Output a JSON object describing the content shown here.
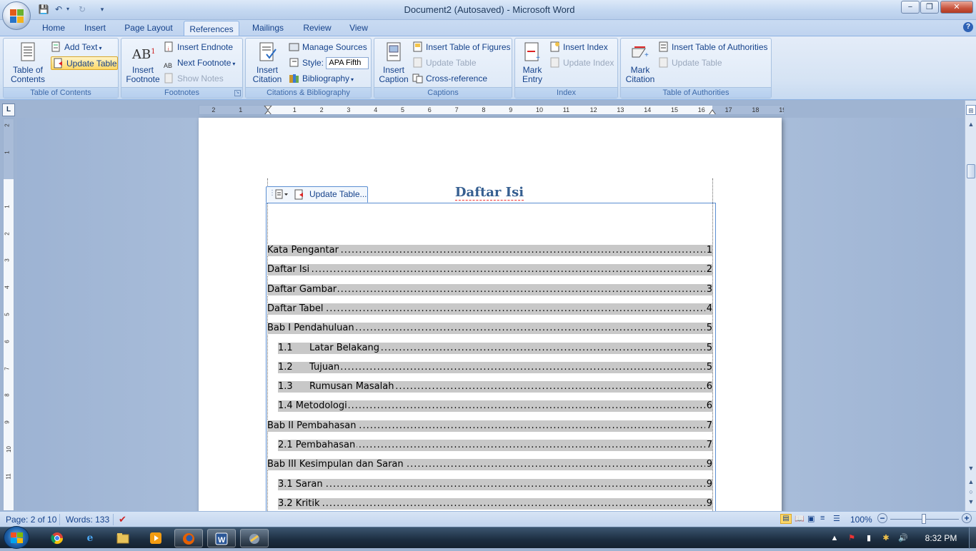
{
  "window": {
    "title": "Document2 (Autosaved) - Microsoft Word",
    "minimize": "−",
    "restore": "❐",
    "close": "✕"
  },
  "tabs": [
    "Home",
    "Insert",
    "Page Layout",
    "References",
    "Mailings",
    "Review",
    "View"
  ],
  "active_tab": "References",
  "ribbon": {
    "toc": {
      "label": "Table of Contents",
      "table_of_contents": "Table of Contents",
      "add_text": "Add Text",
      "update_table": "Update Table"
    },
    "footnotes": {
      "label": "Footnotes",
      "insert_footnote": "Insert Footnote",
      "insert_endnote": "Insert Endnote",
      "next_footnote": "Next Footnote",
      "show_notes": "Show Notes"
    },
    "citations": {
      "label": "Citations & Bibliography",
      "insert_citation": "Insert Citation",
      "manage_sources": "Manage Sources",
      "style_label": "Style:",
      "style_value": "APA Fifth",
      "bibliography": "Bibliography"
    },
    "captions": {
      "label": "Captions",
      "insert_caption": "Insert Caption",
      "insert_table_of_figures": "Insert Table of Figures",
      "update_table": "Update Table",
      "cross_reference": "Cross-reference"
    },
    "index": {
      "label": "Index",
      "mark_entry": "Mark Entry",
      "insert_index": "Insert Index",
      "update_index": "Update Index"
    },
    "authorities": {
      "label": "Table of Authorities",
      "mark_citation": "Mark Citation",
      "insert_toa": "Insert Table of Authorities",
      "update_table": "Update Table"
    }
  },
  "ruler": {
    "numbers": [
      "2",
      "1",
      "1",
      "2",
      "3",
      "4",
      "5",
      "6",
      "7",
      "8",
      "9",
      "10",
      "11",
      "12",
      "13",
      "14",
      "15",
      "16",
      "17",
      "18",
      "19"
    ],
    "vnumbers": [
      "2",
      "1",
      "1",
      "2",
      "3",
      "4",
      "5",
      "6",
      "7",
      "8",
      "9",
      "10",
      "11"
    ],
    "tab_selector": "L"
  },
  "document": {
    "toc_control_label": "Update Table...",
    "heading": "Daftar Isi",
    "toc": [
      {
        "title": "Kata Pengantar",
        "page": "1",
        "level": 1
      },
      {
        "title": "Daftar Isi",
        "page": "2",
        "level": 1
      },
      {
        "title": "Daftar Gambar",
        "page": "3",
        "level": 1
      },
      {
        "title": "Daftar Tabel",
        "page": "4",
        "level": 1
      },
      {
        "title": "Bab I Pendahuluan",
        "page": "5",
        "level": 1
      },
      {
        "num": "1.1",
        "title": "Latar Belakang",
        "page": "5",
        "level": 2
      },
      {
        "num": "1.2",
        "title": "Tujuan",
        "page": "5",
        "level": 2
      },
      {
        "num": "1.3",
        "title": "Rumusan Masalah",
        "page": "6",
        "level": 2
      },
      {
        "title": "1.4 Metodologi",
        "page": "6",
        "level": 2
      },
      {
        "title": "Bab II Pembahasan",
        "page": "7",
        "level": 1
      },
      {
        "title": "2.1 Pembahasan",
        "page": "7",
        "level": 2
      },
      {
        "title": "Bab III Kesimpulan dan Saran",
        "page": "9",
        "level": 1
      },
      {
        "title": "3.1 Saran",
        "page": "9",
        "level": 2
      },
      {
        "title": "3.2 Kritik",
        "page": "9",
        "level": 2
      }
    ]
  },
  "statusbar": {
    "page": "Page: 2 of 10",
    "words": "Words: 133",
    "zoom": "100%"
  },
  "taskbar": {
    "time": "8:32 PM"
  },
  "colors": {
    "accent": "#15428b",
    "heading": "#365f91",
    "toc_shading": "#c8c8c8"
  }
}
